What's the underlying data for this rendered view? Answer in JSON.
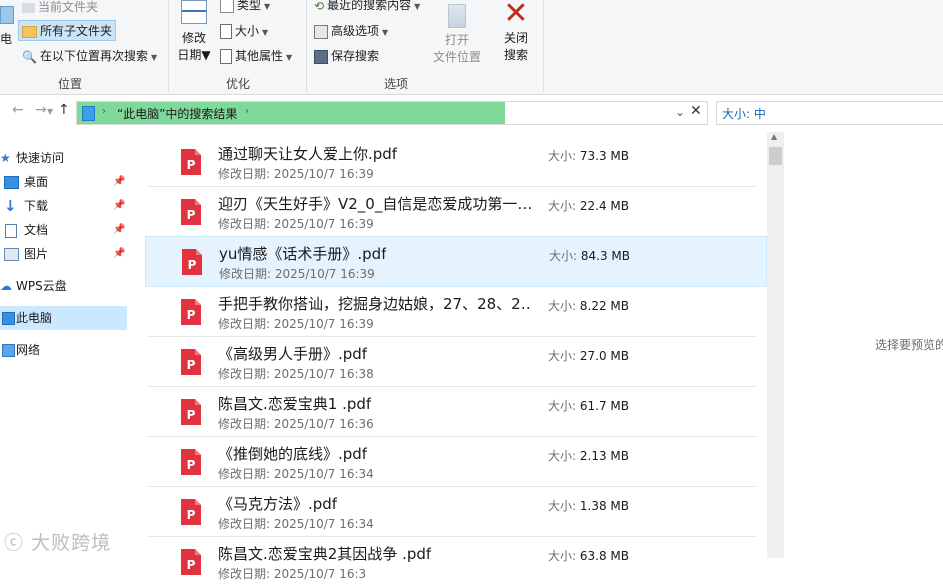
{
  "ribbon": {
    "location_group": {
      "left_big": "电",
      "recent_files": "当前文件夹",
      "all_subfolders": "所有子文件夹",
      "search_again": "在以下位置再次搜索",
      "label": "位置"
    },
    "refine_group": {
      "modify_date_line1": "修改",
      "modify_date_line2": "日期",
      "type": "类型",
      "size": "大小",
      "other_props": "其他属性",
      "label": "优化"
    },
    "options_group": {
      "recent_searches": "最近的搜索内容",
      "advanced_options": "高级选项",
      "save_search": "保存搜索",
      "open_location_line1": "打开",
      "open_location_line2": "文件位置",
      "close_line1": "关闭",
      "close_line2": "搜索",
      "label": "选项"
    }
  },
  "address": {
    "path": "“此电脑”中的搜索结果",
    "search_text": "大小: 中"
  },
  "nav": {
    "quick_access": "快速访问",
    "items": [
      {
        "label": "桌面"
      },
      {
        "label": "下载"
      },
      {
        "label": "文档"
      },
      {
        "label": "图片"
      }
    ],
    "wps": "WPS云盘",
    "this_pc": "此电脑",
    "network": "网络"
  },
  "files": [
    {
      "name": "通过聊天让女人爱上你.pdf",
      "date": "修改日期: 2025/10/7 16:39",
      "size_label": "大小:",
      "size": "73.3 MB"
    },
    {
      "name": "迎刃《天生好手》V2_0_自信是恋爱成功第一…",
      "date": "修改日期: 2025/10/7 16:39",
      "size_label": "大小:",
      "size": "22.4 MB"
    },
    {
      "name": "yu情感《话术手册》.pdf",
      "date": "修改日期: 2025/10/7 16:39",
      "size_label": "大小:",
      "size": "84.3 MB"
    },
    {
      "name": "手把手教你搭讪，挖掘身边姑娘，27、28、2…",
      "date": "修改日期: 2025/10/7 16:39",
      "size_label": "大小:",
      "size": "8.22 MB"
    },
    {
      "name": "《高级男人手册》.pdf",
      "date": "修改日期: 2025/10/7 16:38",
      "size_label": "大小:",
      "size": "27.0 MB"
    },
    {
      "name": "陈昌文.恋爱宝典1 .pdf",
      "date": "修改日期: 2025/10/7 16:36",
      "size_label": "大小:",
      "size": "61.7 MB"
    },
    {
      "name": "《推倒她的底线》.pdf",
      "date": "修改日期: 2025/10/7 16:34",
      "size_label": "大小:",
      "size": "2.13 MB"
    },
    {
      "name": "《马克方法》.pdf",
      "date": "修改日期: 2025/10/7 16:34",
      "size_label": "大小:",
      "size": "1.38 MB"
    },
    {
      "name": "陈昌文.恋爱宝典2其因战争 .pdf",
      "date": "修改日期: 2025/10/7 16:3",
      "size_label": "大小:",
      "size": "63.8 MB"
    }
  ],
  "preview_text": "选择要预览的",
  "watermark": "大败跨境",
  "colors": {
    "address_fill": "#80d89a",
    "selected": "#cce8ff",
    "pdf_red": "#e0333f"
  }
}
